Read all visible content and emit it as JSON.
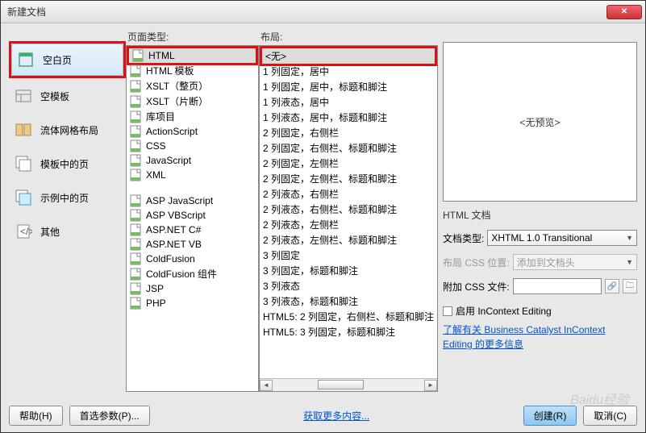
{
  "title": "新建文档",
  "nav": [
    {
      "label": "空白页",
      "selected": true
    },
    {
      "label": "空模板"
    },
    {
      "label": "流体网格布局"
    },
    {
      "label": "模板中的页"
    },
    {
      "label": "示例中的页"
    },
    {
      "label": "其他"
    }
  ],
  "col2": {
    "label": "页面类型:",
    "groups": [
      [
        "HTML",
        "HTML 模板",
        "XSLT（整页）",
        "XSLT（片断）",
        "库项目",
        "ActionScript",
        "CSS",
        "JavaScript",
        "XML"
      ],
      [
        "ASP JavaScript",
        "ASP VBScript",
        "ASP.NET C#",
        "ASP.NET VB",
        "ColdFusion",
        "ColdFusion 组件",
        "JSP",
        "PHP"
      ]
    ],
    "selectedIndex": 0
  },
  "col3": {
    "label": "布局:",
    "items": [
      "<无>",
      "1 列固定，居中",
      "1 列固定，居中，标题和脚注",
      "1 列液态，居中",
      "1 列液态，居中，标题和脚注",
      "2 列固定，右侧栏",
      "2 列固定，右侧栏、标题和脚注",
      "2 列固定，左侧栏",
      "2 列固定，左侧栏、标题和脚注",
      "2 列液态，右侧栏",
      "2 列液态，右侧栏、标题和脚注",
      "2 列液态，左侧栏",
      "2 列液态，左侧栏、标题和脚注",
      "3 列固定",
      "3 列固定，标题和脚注",
      "3 列液态",
      "3 列液态，标题和脚注",
      "HTML5: 2 列固定，右侧栏、标题和脚注",
      "HTML5: 3 列固定，标题和脚注"
    ],
    "selectedIndex": 0
  },
  "preview": {
    "placeholder": "<无预览>",
    "caption": "HTML 文档"
  },
  "form": {
    "doctype_label": "文档类型:",
    "doctype_value": "XHTML 1.0 Transitional",
    "css_pos_label": "布局 CSS 位置:",
    "css_pos_value": "添加到文档头",
    "attach_label": "附加 CSS 文件:",
    "checkbox_label": "启用 InContext Editing",
    "link_text": "了解有关 Business Catalyst InContext Editing 的更多信息"
  },
  "footer": {
    "help": "帮助(H)",
    "prefs": "首选参数(P)...",
    "more": "获取更多内容...",
    "create": "创建(R)",
    "cancel": "取消(C)"
  }
}
